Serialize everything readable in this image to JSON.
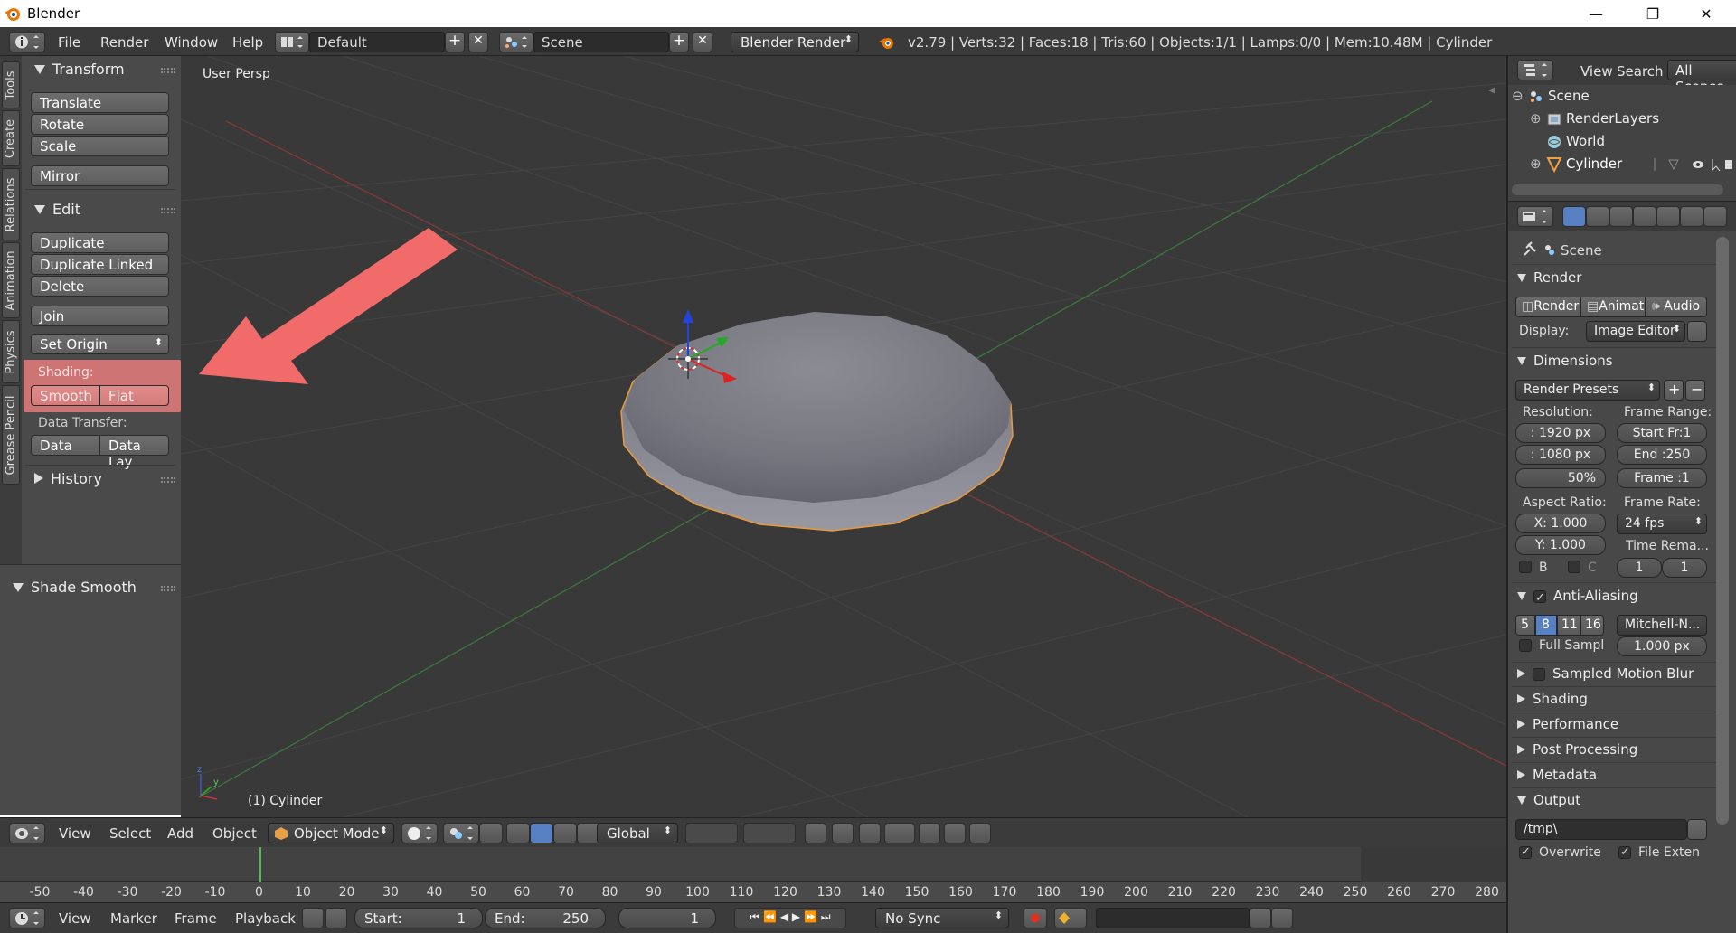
{
  "window": {
    "title": "Blender",
    "minimize": "—",
    "maximize": "❐",
    "close": "✕"
  },
  "info_header": {
    "menus": [
      "File",
      "Render",
      "Window",
      "Help"
    ],
    "screen_layout": "Default",
    "scene": "Scene",
    "render_engine": "Blender Render",
    "stats": "v2.79 | Verts:32 | Faces:18 | Tris:60 | Objects:1/1 | Lamps:0/0 | Mem:10.48M | Cylinder"
  },
  "tool_tabs": [
    "Tools",
    "Create",
    "Relations",
    "Animation",
    "Physics",
    "Grease Pencil"
  ],
  "tool_shelf": {
    "transform": {
      "title": "Transform",
      "buttons": [
        "Translate",
        "Rotate",
        "Scale",
        "Mirror"
      ]
    },
    "edit": {
      "title": "Edit",
      "buttons": [
        "Duplicate",
        "Duplicate Linked",
        "Delete",
        "Join"
      ],
      "set_origin": "Set Origin",
      "shading_label": "Shading:",
      "smooth": "Smooth",
      "flat": "Flat",
      "data_transfer_label": "Data Transfer:",
      "data": "Data",
      "data_lay": "Data Lay"
    },
    "history": {
      "title": "History"
    },
    "operator": {
      "title": "Shade Smooth"
    }
  },
  "viewport": {
    "view_name": "User Persp",
    "object_info": "(1) Cylinder",
    "highlight_color": "#e06060",
    "selection_color": "#f0a040"
  },
  "view3d_header": {
    "menus": [
      "View",
      "Select",
      "Add",
      "Object"
    ],
    "mode": "Object Mode",
    "orientation": "Global"
  },
  "timeline": {
    "ticks": [
      "-50",
      "-40",
      "-30",
      "-20",
      "-10",
      "0",
      "10",
      "20",
      "30",
      "40",
      "50",
      "60",
      "70",
      "80",
      "90",
      "100",
      "110",
      "120",
      "130",
      "140",
      "150",
      "160",
      "170",
      "180",
      "190",
      "200",
      "210",
      "220",
      "230",
      "240",
      "250",
      "260",
      "270",
      "280"
    ],
    "current_frame_marker": "0"
  },
  "timeline_header": {
    "menus": [
      "View",
      "Marker",
      "Frame",
      "Playback"
    ],
    "start_label": "Start:",
    "start_value": "1",
    "end_label": "End:",
    "end_value": "250",
    "current_frame": "1",
    "sync": "No Sync"
  },
  "outliner": {
    "menus": [
      "View",
      "Search"
    ],
    "filter": "All Scenes",
    "items": [
      "Scene",
      "RenderLayers",
      "World",
      "Cylinder"
    ]
  },
  "properties": {
    "context": "Scene",
    "render": {
      "title": "Render",
      "buttons": [
        "Render",
        "Animati",
        "Audio"
      ],
      "display_label": "Display:",
      "display_value": "Image Editor"
    },
    "dimensions": {
      "title": "Dimensions",
      "presets": "Render Presets",
      "resolution_label": "Resolution:",
      "res_x": ": 1920 px",
      "res_y": ": 1080 px",
      "res_pct": "50%",
      "frame_range_label": "Frame Range:",
      "start": "Start Fr:1",
      "end": "End :250",
      "frame": "Frame :1",
      "aspect_label": "Aspect Ratio:",
      "aspect_x": "X:  1.000",
      "aspect_y": "Y:  1.000",
      "frame_rate_label": "Frame Rate:",
      "fps": "24 fps",
      "time_remap_label": "Time Rema...",
      "b": "B",
      "c": "C",
      "remap_old": "1",
      "remap_new": "1"
    },
    "anti_aliasing": {
      "title": "Anti-Aliasing",
      "samples": [
        "5",
        "8",
        "11",
        "16"
      ],
      "filter": "Mitchell-N...",
      "full_sample": "Full Sampl",
      "size": "1.000 px"
    },
    "collapsed": [
      "Sampled Motion Blur",
      "Shading",
      "Performance",
      "Post Processing",
      "Metadata"
    ],
    "output": {
      "title": "Output",
      "path": "/tmp\\",
      "overwrite": "Overwrite",
      "file_ext": "File Exten"
    }
  }
}
